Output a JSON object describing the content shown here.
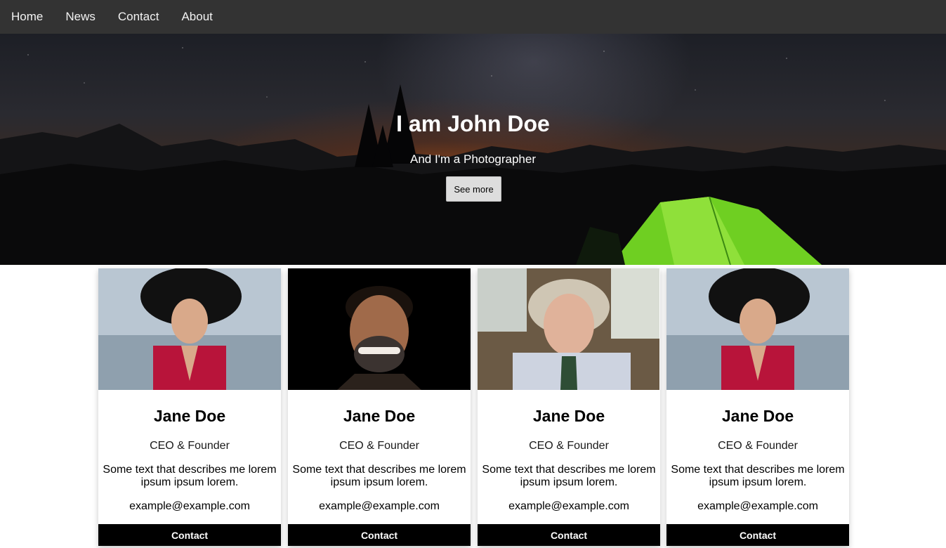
{
  "nav": {
    "items": [
      {
        "label": "Home"
      },
      {
        "label": "News"
      },
      {
        "label": "Contact"
      },
      {
        "label": "About"
      }
    ]
  },
  "hero": {
    "title": "I am John Doe",
    "subtitle": "And I'm a Photographer",
    "button_label": "See more"
  },
  "team": [
    {
      "name": "Jane Doe",
      "title": "CEO & Founder",
      "description": "Some text that describes me lorem ipsum ipsum lorem.",
      "email": "example@example.com",
      "button_label": "Contact"
    },
    {
      "name": "Jane Doe",
      "title": "CEO & Founder",
      "description": "Some text that describes me lorem ipsum ipsum lorem.",
      "email": "example@example.com",
      "button_label": "Contact"
    },
    {
      "name": "Jane Doe",
      "title": "CEO & Founder",
      "description": "Some text that describes me lorem ipsum ipsum lorem.",
      "email": "example@example.com",
      "button_label": "Contact"
    },
    {
      "name": "Jane Doe",
      "title": "CEO & Founder",
      "description": "Some text that describes me lorem ipsum ipsum lorem.",
      "email": "example@example.com",
      "button_label": "Contact"
    }
  ],
  "colors": {
    "nav_bg": "#333333",
    "nav_text": "#f2f2f2",
    "card_button_bg": "#000000",
    "hero_button_bg": "#dddddd"
  }
}
